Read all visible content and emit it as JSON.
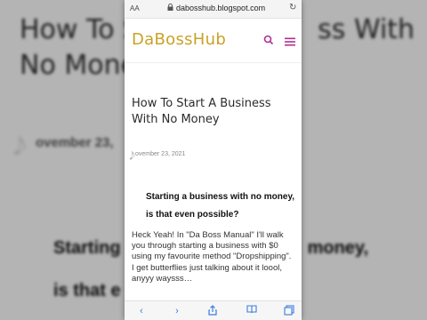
{
  "browser": {
    "text_size_label": "AA",
    "url": "dabosshub.blogspot.com"
  },
  "site": {
    "brand": "DaBossHub",
    "accent_color": "#c9a227",
    "icon_color": "#b0308f"
  },
  "post": {
    "title": "How To Start A Business With No Money",
    "date": "ovember 23, 2021",
    "lead_line_1": "Starting a business with no money,",
    "lead_line_2": "is that even possible?",
    "body_lines": [
      "Heck Yeah! In \"Da Boss Manual\" I'll walk",
      "you through starting a business with $0",
      "using my favourite method \"Dropshipping\".",
      "I get butterflies just talking about it loool,",
      "anyyy waysss…"
    ]
  },
  "background": {
    "title_line_1": "How To S",
    "title_line_2": "No Mone",
    "title_right": "ss With",
    "date_fragment": "ovember 23,",
    "strong_line_1": "Starting",
    "strong_line_1_right": "money,",
    "strong_line_2": "is that e"
  }
}
